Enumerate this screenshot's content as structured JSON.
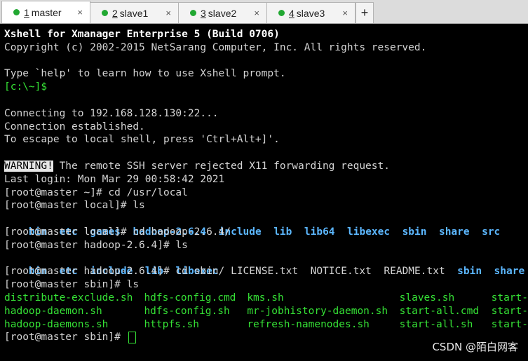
{
  "tabs": [
    {
      "num": "1",
      "label": "master",
      "active": true
    },
    {
      "num": "2",
      "label": "slave1",
      "active": false
    },
    {
      "num": "3",
      "label": "slave2",
      "active": false
    },
    {
      "num": "4",
      "label": "slave3",
      "active": false
    }
  ],
  "tab_close_glyph": "×",
  "new_tab_glyph": "+",
  "terminal": {
    "banner1": "Xshell for Xmanager Enterprise 5 (Build 0706)",
    "banner2": "Copyright (c) 2002-2015 NetSarang Computer, Inc. All rights reserved.",
    "help": "Type `help' to learn how to use Xshell prompt.",
    "local_prompt": "[c:\\~]$",
    "connecting": "Connecting to 192.168.128.130:22...",
    "established": "Connection established.",
    "escape": "To escape to local shell, press 'Ctrl+Alt+]'.",
    "warning_tag": "WARNING!",
    "warning_text": " The remote SSH server rejected X11 forwarding request.",
    "last_login": "Last login: Mon Mar 29 00:58:42 2021",
    "cmd1": "[root@master ~]# cd /usr/local",
    "cmd2": "[root@master local]# ls",
    "ls1": [
      "bin",
      "etc",
      "games",
      "hadoop-2.6.4",
      "include",
      "lib",
      "lib64",
      "libexec",
      "sbin",
      "share",
      "src"
    ],
    "cmd3": "[root@master local]# cd hadoop-2.6.4/",
    "cmd4": "[root@master hadoop-2.6.4]# ls",
    "ls2_dirs_a": [
      "bin",
      "etc",
      "include",
      "lib",
      "libexec"
    ],
    "ls2_files": [
      "LICENSE.txt",
      "NOTICE.txt",
      "README.txt"
    ],
    "ls2_dirs_b": [
      "sbin",
      "share"
    ],
    "cmd5": "[root@master hadoop-2.6.4]# cd sbin/",
    "cmd6": "[root@master sbin]# ls",
    "ls3": [
      [
        "distribute-exclude.sh",
        "hdfs-config.cmd",
        "kms.sh",
        "slaves.sh",
        "start-"
      ],
      [
        "hadoop-daemon.sh",
        "hdfs-config.sh",
        "mr-jobhistory-daemon.sh",
        "start-all.cmd",
        "start-"
      ],
      [
        "hadoop-daemons.sh",
        "httpfs.sh",
        "refresh-namenodes.sh",
        "start-all.sh",
        "start-"
      ]
    ],
    "final_prompt": "[root@master sbin]# "
  },
  "watermark": "CSDN @陌白网客",
  "colors": {
    "dir": "#5cb7ff",
    "exe": "#35e035",
    "tab_dot": "#21a832"
  }
}
